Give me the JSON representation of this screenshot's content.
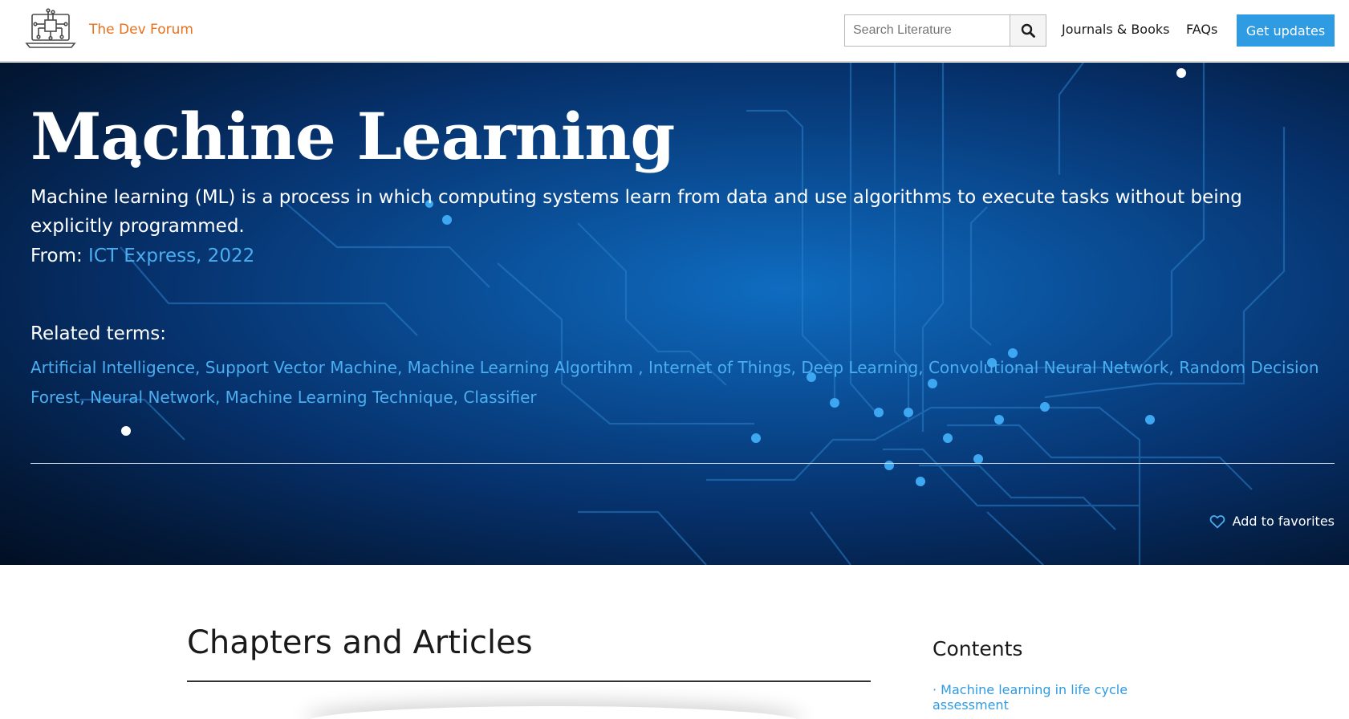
{
  "header": {
    "site_name": "The Dev Forum",
    "search_placeholder": "Search Literature",
    "nav": {
      "journals": "Journals & Books",
      "faqs": "FAQs",
      "updates_button": "Get updates"
    }
  },
  "hero": {
    "title": "Machine Learning",
    "description": "Machine learning (ML) is a process in which computing systems learn from data and use algorithms to execute tasks without being explicitly programmed.",
    "from_label": "From:",
    "from_source": "ICT Express, 2022",
    "related_heading": "Related terms:",
    "related_terms": [
      "Artificial Intelligence",
      "Support Vector Machine",
      "Machine Learning Algortihm ",
      "Internet of Things",
      "Deep Learning",
      "Convolutional Neural Network",
      "Random Decision Forest",
      "Neural Network",
      "Machine Learning Technique",
      "Classifier"
    ],
    "favorites_label": "Add to favorites"
  },
  "main": {
    "section_title": "Chapters and Articles",
    "contents_title": "Contents",
    "contents_items": [
      "· Machine learning in life cycle assessment"
    ]
  },
  "colors": {
    "brand_orange": "#e9711c",
    "link_blue": "#4aaef0",
    "button_blue": "#2f9be2",
    "hero_dark": "#031938"
  },
  "icons": {
    "logo": "circuit-laptop-logo",
    "search": "magnifier-icon",
    "favorite": "heart-outline-icon"
  }
}
